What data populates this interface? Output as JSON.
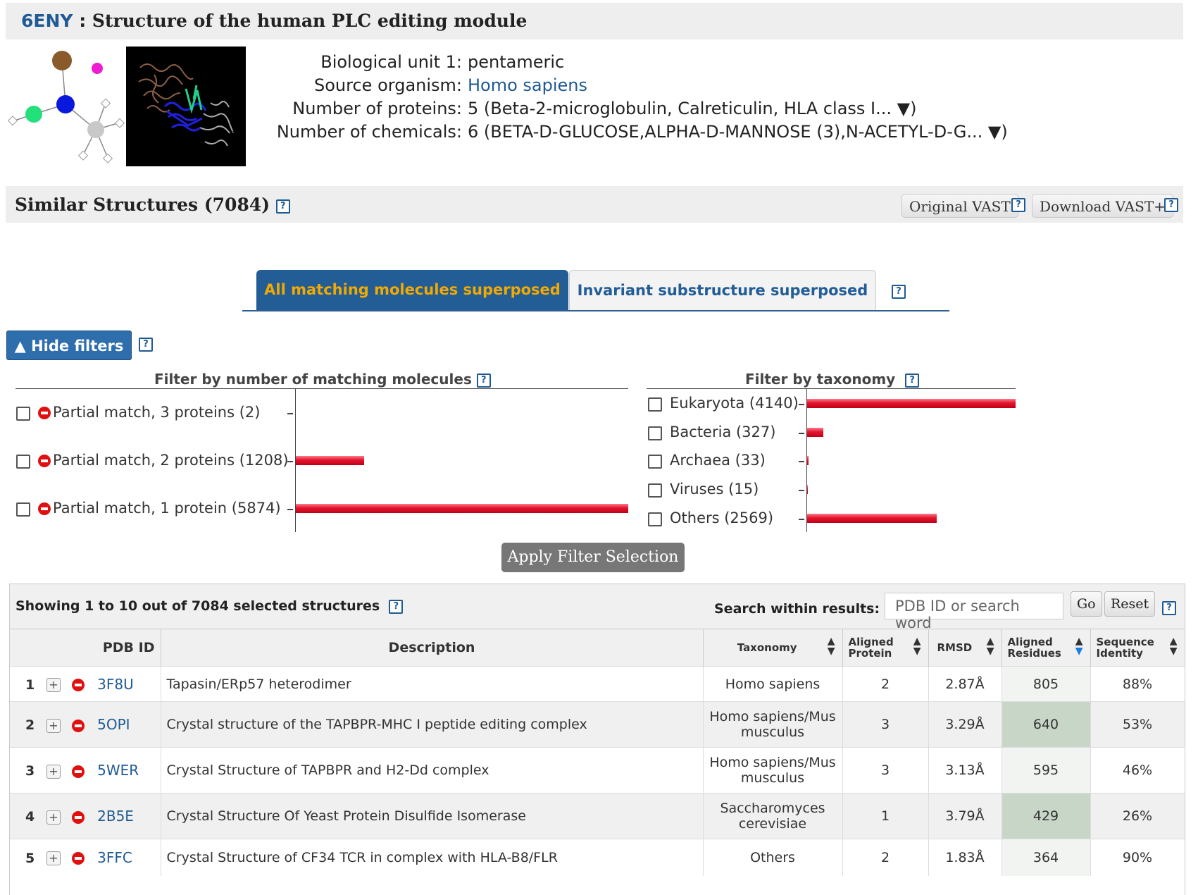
{
  "header": {
    "pdb_id": "6ENY",
    "separator": " : ",
    "title": "Structure of the human PLC editing module"
  },
  "info": {
    "bio_unit_label": "Biological unit 1:",
    "bio_unit_value": "pentameric",
    "organism_label": "Source organism:",
    "organism_value": "Homo sapiens",
    "proteins_label": "Number of proteins:",
    "proteins_value": "5 (Beta-2-microglobulin, Calreticulin, HLA class I... ▼)",
    "chemicals_label": "Number of chemicals:",
    "chemicals_value": "6 (BETA-D-GLUCOSE,ALPHA-D-MANNOSE (3),N-ACETYL-D-G... ▼)"
  },
  "similar": {
    "title": "Similar Structures (7084)",
    "original_vast": "Original VAST",
    "download_vast": "Download VAST+"
  },
  "tabs": [
    "All matching molecules superposed",
    "Invariant substructure superposed"
  ],
  "filters": {
    "hide_label": "▲ Hide filters",
    "molecules_title": "Filter by number of matching molecules",
    "molecules": [
      {
        "label": "Partial match, 3 proteins (2)",
        "count": 2
      },
      {
        "label": "Partial match, 2 proteins (1208)",
        "count": 1208
      },
      {
        "label": "Partial match, 1 protein (5874)",
        "count": 5874
      }
    ],
    "taxonomy_title": "Filter by taxonomy",
    "taxonomy": [
      {
        "label": "Eukaryota (4140)",
        "count": 4140
      },
      {
        "label": "Bacteria (327)",
        "count": 327
      },
      {
        "label": "Archaea (33)",
        "count": 33
      },
      {
        "label": "Viruses (15)",
        "count": 15
      },
      {
        "label": "Others (2569)",
        "count": 2569
      }
    ],
    "apply_label": "Apply Filter Selection"
  },
  "results": {
    "showing": "Showing 1 to 10 out of 7084 selected structures",
    "search_label": "Search within results:",
    "search_placeholder": "PDB ID or search word",
    "go": "Go",
    "reset": "Reset",
    "columns": {
      "pdb_id": "PDB ID",
      "description": "Description",
      "taxonomy": "Taxonomy",
      "aligned_protein_1": "Aligned",
      "aligned_protein_2": "Protein",
      "rmsd": "RMSD",
      "aligned_residues_1": "Aligned",
      "aligned_residues_2": "Residues",
      "seq_identity_1": "Sequence",
      "seq_identity_2": "Identity"
    },
    "rows": [
      {
        "n": "1",
        "pdb": "3F8U",
        "desc": "Tapasin/ERp57 heterodimer",
        "tax": "Homo sapiens",
        "ap": "2",
        "rmsd": "2.87Å",
        "ar": "805",
        "si": "88%"
      },
      {
        "n": "2",
        "pdb": "5OPI",
        "desc": "Crystal structure of the TAPBPR-MHC I peptide editing complex",
        "tax": "Homo sapiens/Mus musculus",
        "ap": "3",
        "rmsd": "3.29Å",
        "ar": "640",
        "si": "53%"
      },
      {
        "n": "3",
        "pdb": "5WER",
        "desc": "Crystal Structure of TAPBPR and H2-Dd complex",
        "tax": "Homo sapiens/Mus musculus",
        "ap": "3",
        "rmsd": "3.13Å",
        "ar": "595",
        "si": "46%"
      },
      {
        "n": "4",
        "pdb": "2B5E",
        "desc": "Crystal Structure Of Yeast Protein Disulfide Isomerase",
        "tax": "Saccharomyces cerevisiae",
        "ap": "1",
        "rmsd": "3.79Å",
        "ar": "429",
        "si": "26%"
      },
      {
        "n": "5",
        "pdb": "3FFC",
        "desc": "Crystal Structure of CF34 TCR in complex with HLA-B8/FLR",
        "tax": "Others",
        "ap": "2",
        "rmsd": "1.83Å",
        "ar": "364",
        "si": "90%"
      }
    ]
  }
}
